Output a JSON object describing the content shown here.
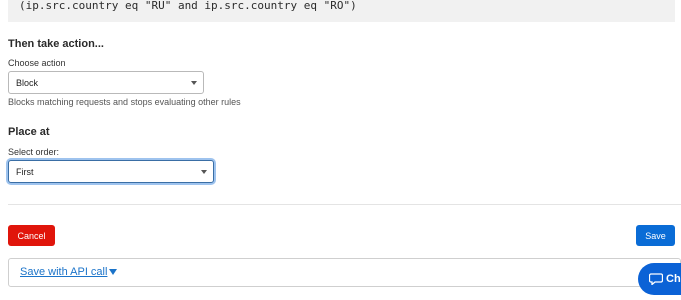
{
  "expression": {
    "text": "(ip.src.country eq \"RU\" and ip.src.country eq \"RO\")"
  },
  "action_section": {
    "heading": "Then take action...",
    "label": "Choose action",
    "selected": "Block",
    "help": "Blocks matching requests and stops evaluating other rules"
  },
  "place_section": {
    "heading": "Place at",
    "label": "Select order:",
    "selected": "First"
  },
  "footer": {
    "cancel_label": "Cancel",
    "save_label": "Save"
  },
  "api": {
    "link_label": "Save with API call"
  },
  "chat": {
    "label": "Ch"
  },
  "colors": {
    "cancel": "#e0150b",
    "save": "#0a6cd6",
    "link": "#1a73c9",
    "focus_ring": "#9ec3ee"
  }
}
